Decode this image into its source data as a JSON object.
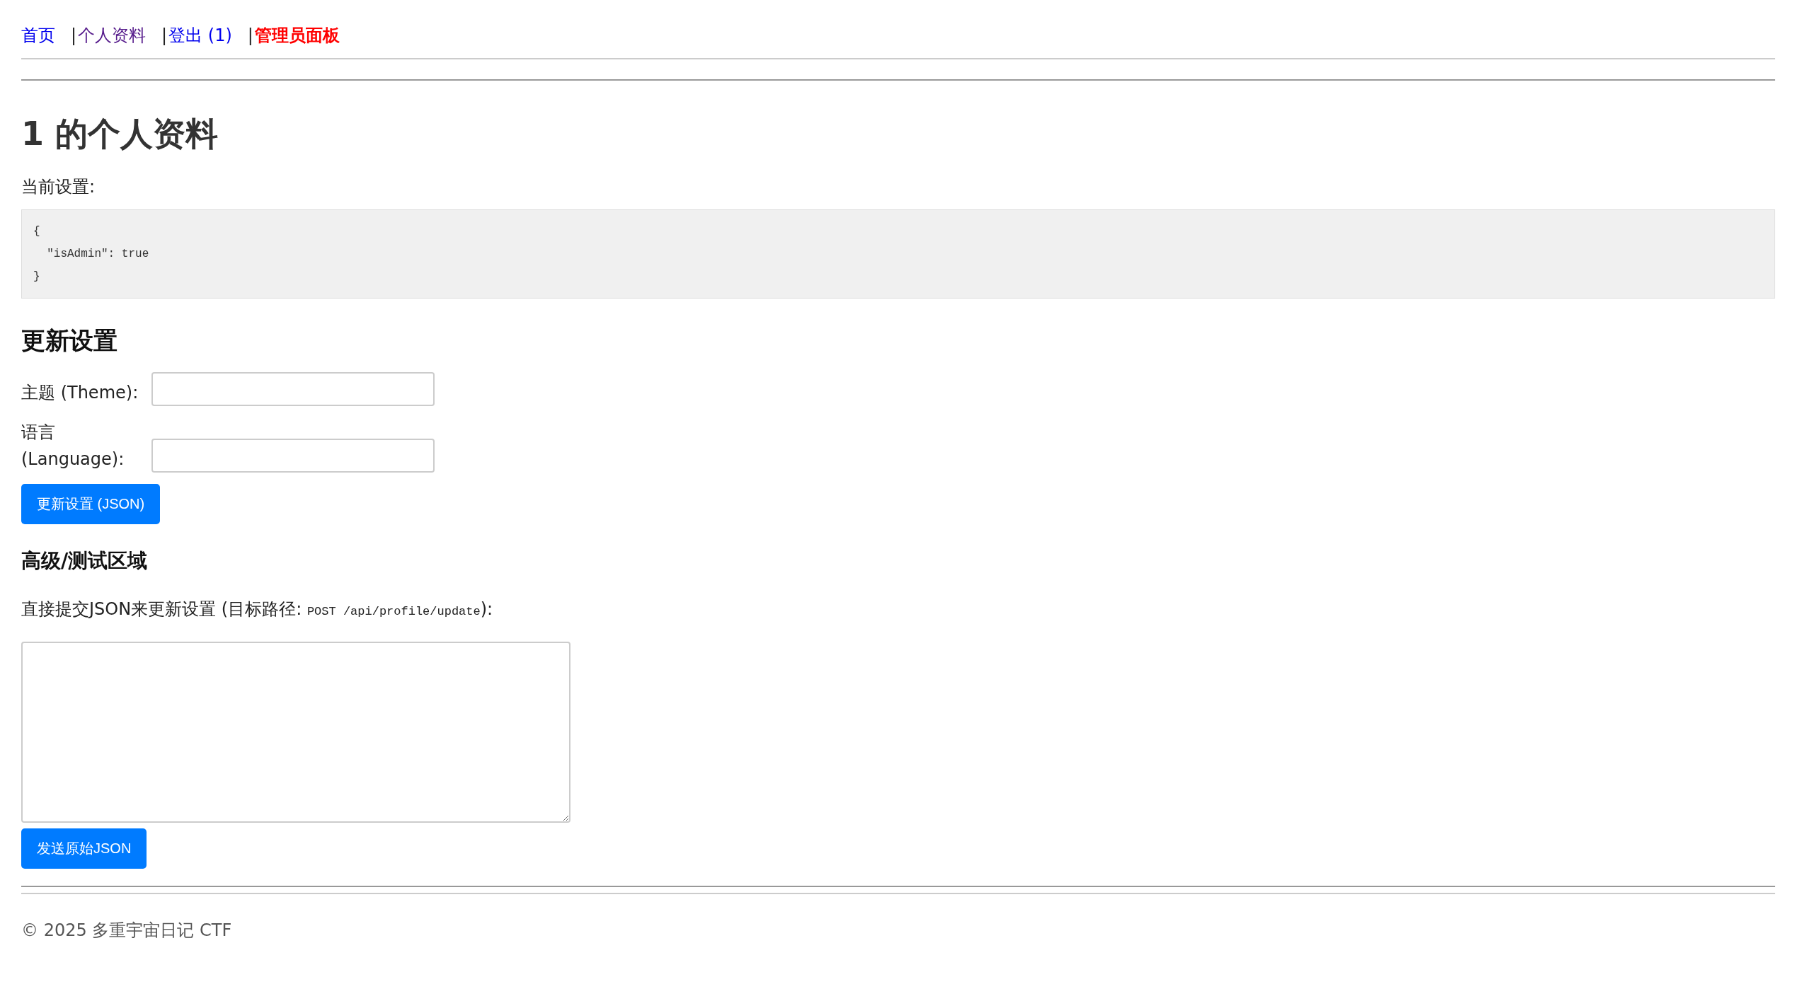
{
  "nav": [
    {
      "label": "首页",
      "kind": "link"
    },
    {
      "separator": "|",
      "label": "个人资料",
      "kind": "visited"
    },
    {
      "separator": "|",
      "label": "登出 (1)",
      "kind": "link"
    },
    {
      "separator": "|",
      "label": "管理员面板",
      "kind": "admin"
    }
  ],
  "title": "1 的个人资料",
  "current_settings": {
    "label": "当前设置:",
    "code": "{\n  \"isAdmin\": true\n}"
  },
  "update_form": {
    "heading": "更新设置",
    "fields": [
      {
        "label": "主题 (Theme):"
      },
      {
        "label": "语言 (Language):"
      }
    ],
    "button": "更新设置 (JSON)"
  },
  "advanced": {
    "heading": "高级/测试区域",
    "instruction": {
      "before": "直接提交JSON来更新设置 (目标路径: ",
      "code": "POST /api/profile/update",
      "after": "):"
    },
    "button": "发送原始JSON"
  },
  "footer": "© 2025 多重宇宙日记 CTF"
}
